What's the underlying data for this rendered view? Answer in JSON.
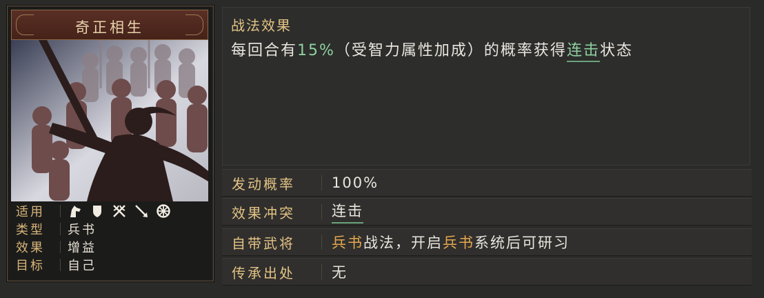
{
  "card": {
    "title": "奇正相生",
    "meta": {
      "apply_label": "适用",
      "apply_icons": [
        "horse-icon",
        "shield-icon",
        "crossed-bows-icon",
        "spear-icon",
        "wheel-icon"
      ],
      "type_label": "类型",
      "type_value": "兵书",
      "effect_label": "效果",
      "effect_value": "增益",
      "target_label": "目标",
      "target_value": "自己"
    }
  },
  "effect": {
    "heading": "战法效果",
    "desc_part1": "每回合有",
    "desc_rate": "15%",
    "desc_part2": "（受智力属性加成）的概率获得",
    "desc_link": "连击",
    "desc_part3": "状态"
  },
  "rows": {
    "trigger_label": "发动概率",
    "trigger_value": "100%",
    "conflict_label": "效果冲突",
    "conflict_value": "连击",
    "general_label": "自带武将",
    "general_part1": "兵书",
    "general_part2": "战法，开启",
    "general_part3": "兵书",
    "general_part4": "系统后可研习",
    "inherit_label": "传承出处",
    "inherit_value": "无"
  },
  "colors": {
    "accent_gold": "#e3c385",
    "highlight_green": "#8fd1a0",
    "highlight_orange": "#e6a74f",
    "panel_bg": "#2d2d2c"
  }
}
